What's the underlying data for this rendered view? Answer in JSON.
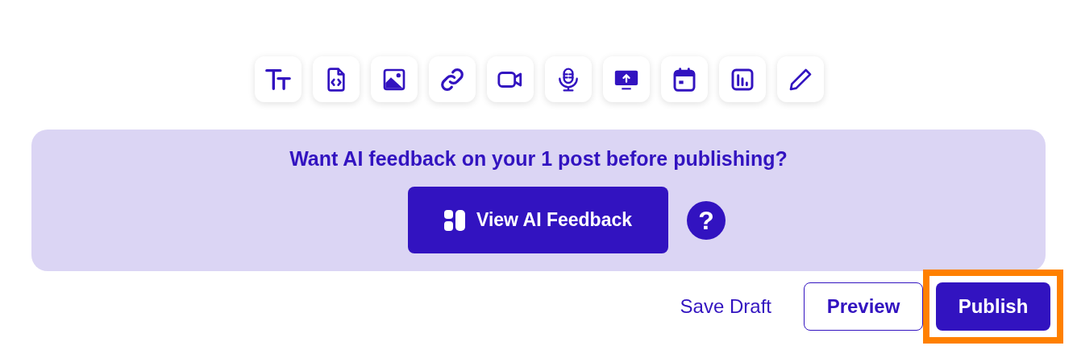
{
  "feedback_banner": {
    "heading": "Want AI feedback on your 1 post before publishing?",
    "button": "View AI Feedback",
    "help": "?"
  },
  "actions": [
    {
      "kind": "link",
      "label": "Save Draft",
      "highlighted": false
    },
    {
      "kind": "outline",
      "label": "Preview",
      "highlighted": false
    },
    {
      "kind": "primary",
      "label": "Publish",
      "highlighted": true
    }
  ]
}
